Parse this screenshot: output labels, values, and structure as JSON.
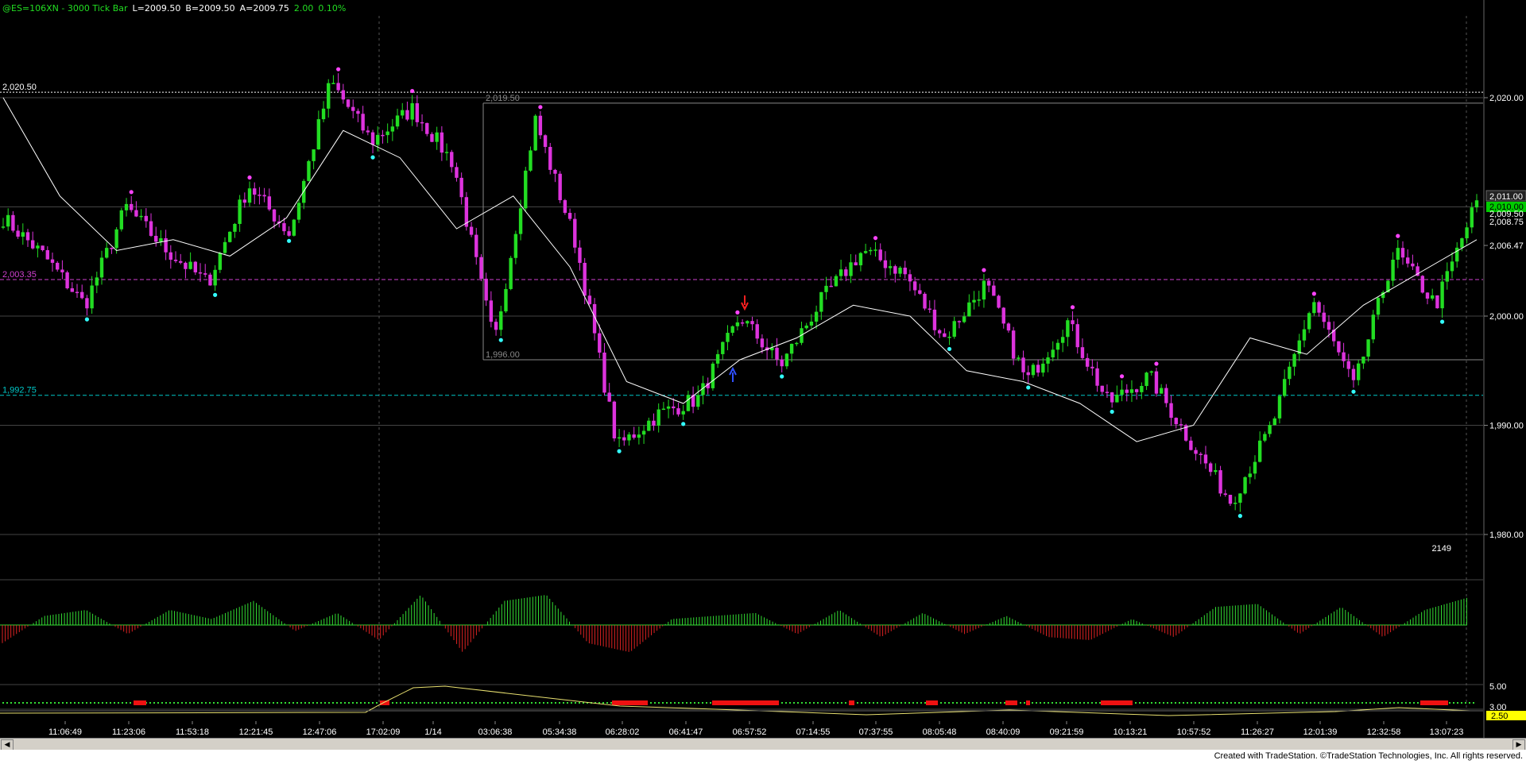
{
  "header": {
    "symbol": "@ES=106XN - 3000 Tick Bar",
    "low": "L=2009.50",
    "bid": "B=2009.50",
    "ask": "A=2009.75",
    "change": "2.00",
    "change_pct": "0.10%"
  },
  "price_axis": {
    "ticks": [
      "2,020.00",
      "2,011.00",
      "2,010.00",
      "2,009.50",
      "2,008.75",
      "2,006.47",
      "2,000.00",
      "1,990.00",
      "1,980.00"
    ]
  },
  "horizontal_lines": [
    {
      "label": "2,020.50",
      "value": 2020.5,
      "color": "#ffffff",
      "style": "dotted"
    },
    {
      "label": "2,019.50",
      "value": 2019.5,
      "color": "#888888",
      "style": "solid"
    },
    {
      "label": "2,003.35",
      "value": 2003.35,
      "color": "#d040d0",
      "style": "dashed"
    },
    {
      "label": "1,996.00",
      "value": 1996.0,
      "color": "#888888",
      "style": "solid"
    },
    {
      "label": "1,992.75",
      "value": 1992.75,
      "color": "#00c8c8",
      "style": "dashed"
    }
  ],
  "last_price_label": "2,009.50",
  "volume_label": "2149",
  "lower_axis_labels": [
    "5.00",
    "3.00",
    "2.50"
  ],
  "time_axis": {
    "labels": [
      "11:06:49",
      "11:23:06",
      "11:53:18",
      "12:21:45",
      "12:47:06",
      "17:02:09",
      "1/14",
      "03:06:38",
      "05:34:38",
      "06:28:02",
      "06:41:47",
      "06:57:52",
      "07:14:55",
      "07:37:55",
      "08:05:48",
      "08:40:09",
      "09:21:59",
      "10:13:21",
      "10:57:52",
      "11:26:27",
      "12:01:39",
      "12:32:58",
      "13:07:23"
    ]
  },
  "footer": {
    "text": "Created with TradeStation. ©TradeStation Technologies, Inc. All rights reserved."
  },
  "colors": {
    "up": "#22dd22",
    "down": "#dd33dd",
    "high_dot": "#ff44ff",
    "low_dot": "#33ffff",
    "ma": "#ffffff",
    "hist_pos": "#33dd33",
    "hist_neg": "#dd2222",
    "osc": "#e8e070"
  },
  "chart_data": {
    "type": "candlestick",
    "title": "@ES=106XN - 3000 Tick Bar",
    "ylim": [
      1977.0,
      2023.5
    ],
    "x": [
      "11:06:49",
      "11:23:06",
      "11:53:18",
      "12:21:45",
      "12:47:06",
      "17:02:09",
      "1/14",
      "03:06:38",
      "05:34:38",
      "06:28:02",
      "06:41:47",
      "06:57:52",
      "07:14:55",
      "07:37:55",
      "08:05:48",
      "08:40:09",
      "09:21:59",
      "10:13:21",
      "10:57:52",
      "11:26:27",
      "12:01:39",
      "12:32:58",
      "13:07:23"
    ],
    "close_path": [
      2009.0,
      2005.5,
      2001.0,
      2010.0,
      2006.0,
      2003.0,
      2012.0,
      2007.5,
      2021.5,
      2016.0,
      2019.0,
      2014.0,
      1997.5,
      2018.0,
      2006.5,
      1988.0,
      1991.0,
      1992.5,
      2000.0,
      1995.5,
      2001.5,
      2006.0,
      2004.0,
      1998.0,
      2003.0,
      1994.0,
      1999.5,
      1992.0,
      1994.5,
      1988.5,
      1983.0,
      1990.0,
      2001.5,
      1993.5,
      2006.0,
      2001.0,
      2010.5
    ],
    "moving_average_path": [
      2020.0,
      2011.0,
      2006.0,
      2007.0,
      2005.5,
      2009.0,
      2017.0,
      2014.5,
      2008.0,
      2011.0,
      2004.5,
      1994.0,
      1992.0,
      1996.0,
      1998.0,
      2001.0,
      2000.0,
      1995.0,
      1994.0,
      1992.0,
      1988.5,
      1990.0,
      1998.0,
      1996.5,
      2001.0,
      2004.0,
      2007.0
    ],
    "histogram_values": [
      -0.6,
      0.3,
      0.5,
      -0.3,
      0.5,
      0.2,
      0.8,
      -0.2,
      0.4,
      -0.5,
      1.0,
      -0.9,
      0.8,
      1.0,
      -0.6,
      -0.9,
      0.2,
      0.3,
      0.4,
      -0.3,
      0.5,
      -0.4,
      0.4,
      -0.3,
      0.3,
      -0.4,
      -0.5,
      0.2,
      -0.4,
      0.6,
      0.7,
      -0.3,
      0.6,
      -0.4,
      0.5,
      0.9
    ]
  }
}
